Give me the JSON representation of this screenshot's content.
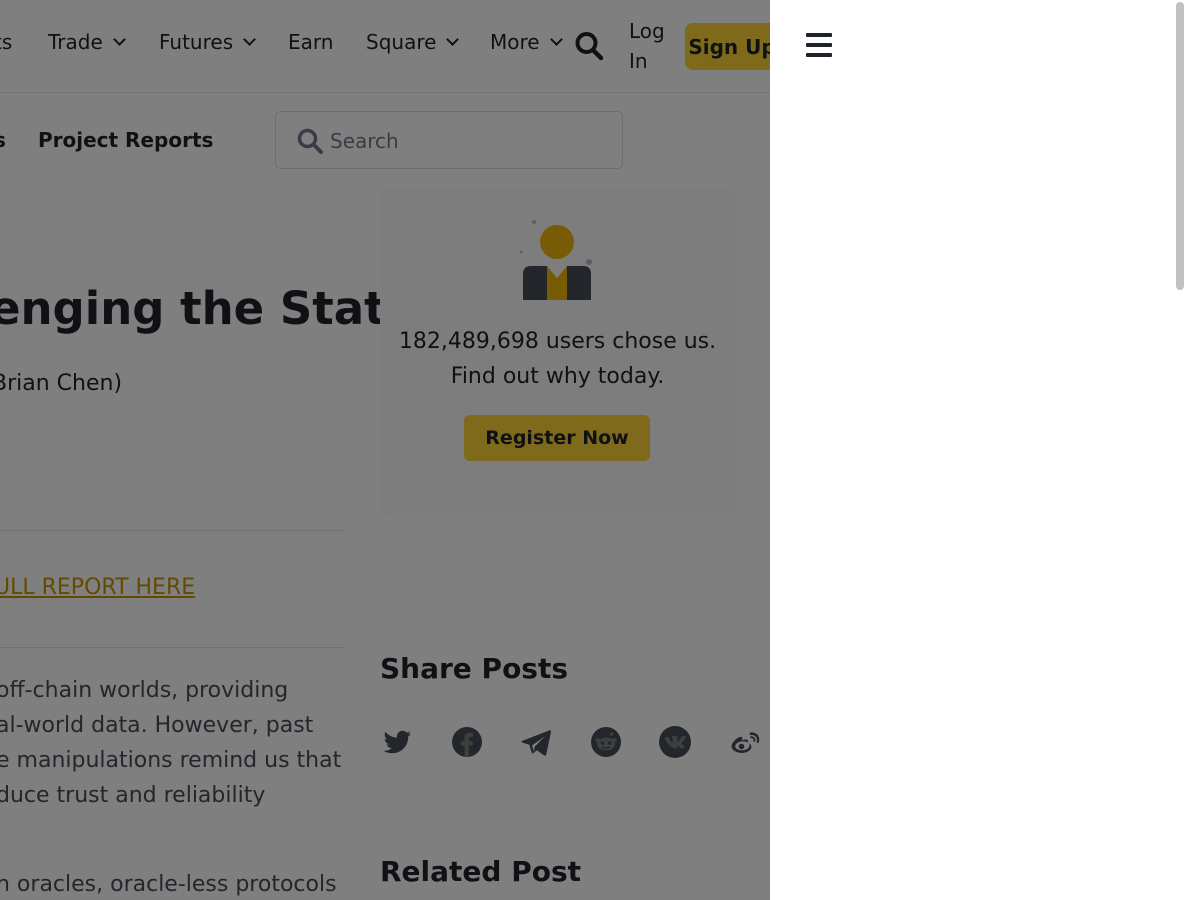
{
  "nav": {
    "items": [
      {
        "label": "ts",
        "has_dropdown": false
      },
      {
        "label": "Trade",
        "has_dropdown": true
      },
      {
        "label": "Futures",
        "has_dropdown": true
      },
      {
        "label": "Earn",
        "has_dropdown": false
      },
      {
        "label": "Square",
        "has_dropdown": true
      },
      {
        "label": "More",
        "has_dropdown": true
      }
    ],
    "login_label": "Log In",
    "signup_label": "Sign Up"
  },
  "subnav": {
    "cut_label": "s",
    "project_reports_label": "Project Reports",
    "search_placeholder": "Search"
  },
  "article": {
    "title": "enging the Status (",
    "author": "Brian Chen)",
    "report_link": "ULL REPORT HERE",
    "body_lines": [
      "off-chain worlds, providing",
      "al-world data. However, past",
      "e manipulations remind us that",
      "duce trust and reliability"
    ],
    "body_line_2": "n oracles, oracle-less protocols"
  },
  "promo": {
    "text": "182,489,698 users chose us. Find out why today.",
    "register_label": "Register Now"
  },
  "share": {
    "title": "Share Posts",
    "icons": [
      "twitter-icon",
      "facebook-icon",
      "telegram-icon",
      "reddit-icon",
      "vk-icon",
      "weibo-icon"
    ]
  },
  "related": {
    "title": "Related Post"
  },
  "colors": {
    "accent": "#fcd535",
    "link": "#c99400",
    "text": "#1e2329",
    "overlay": "rgba(0,0,0,0.5)"
  }
}
